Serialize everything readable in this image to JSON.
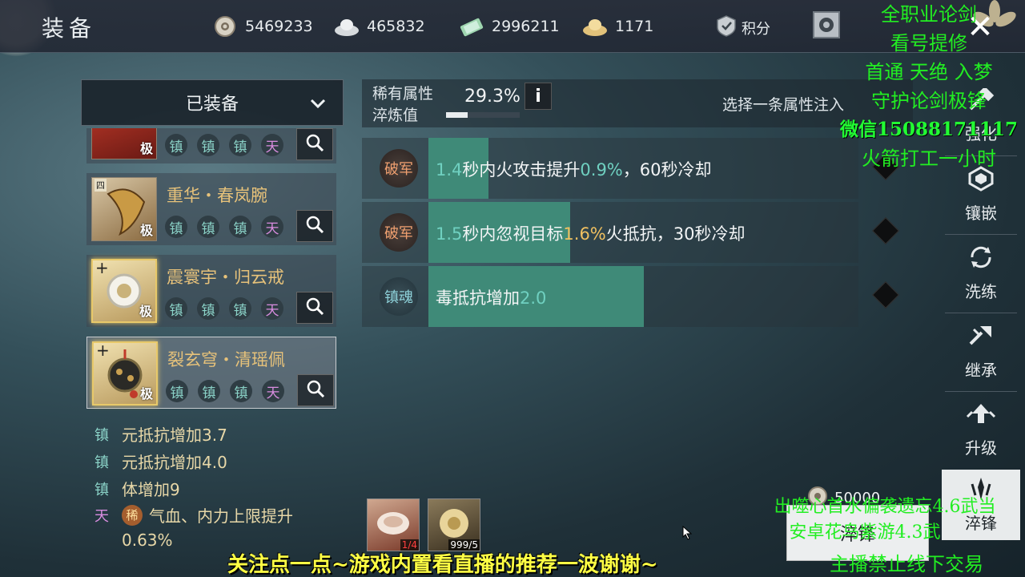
{
  "header": {
    "title": "装备",
    "currencies": [
      {
        "icon": "coin-icon",
        "value": "5469233"
      },
      {
        "icon": "silver-ingot-icon",
        "value": "465832"
      },
      {
        "icon": "jade-ticket-icon",
        "value": "2996211"
      },
      {
        "icon": "gold-ingot-icon",
        "value": "1171"
      }
    ],
    "score_label": "积分"
  },
  "left": {
    "dropdown_label": "已装备",
    "items": [
      {
        "name": "",
        "grade": "极",
        "gems": [
          "镇",
          "镇",
          "镇",
          "天"
        ]
      },
      {
        "name": "重华・春岚腕",
        "grade": "极",
        "gems": [
          "镇",
          "镇",
          "镇",
          "天"
        ],
        "badge": "四"
      },
      {
        "name": "震寰宇・归云戒",
        "grade": "极",
        "gems": [
          "镇",
          "镇",
          "镇",
          "天"
        ],
        "badge": "+"
      },
      {
        "name": "裂玄穹・清瑶佩",
        "grade": "极",
        "gems": [
          "镇",
          "镇",
          "镇",
          "天"
        ],
        "badge": "+",
        "selected": true
      }
    ],
    "attributes": [
      {
        "tag": "镇",
        "text": "元抵抗增加3.7"
      },
      {
        "tag": "镇",
        "text": "元抵抗增加4.0"
      },
      {
        "tag": "镇",
        "text": "体增加9"
      },
      {
        "tag": "天",
        "rare": "稀",
        "text": "气血、内力上限提升",
        "text2": "0.63%"
      }
    ]
  },
  "rarity": {
    "label_line1": "稀有属性",
    "label_line2": "淬炼值",
    "percent": "29.3%",
    "progress": 0.293,
    "info": "i",
    "select_hint": "选择一条属性注入"
  },
  "inject_rows": [
    {
      "type": "破军",
      "fill": 0.14,
      "v1": "1.4",
      "t1": "秒内火攻击提升",
      "v2": "0.9%",
      "t2": "，60秒冷却"
    },
    {
      "type": "破军",
      "fill": 0.33,
      "v1": "1.5",
      "t1": "秒内忽视目标",
      "v2": "1.6%",
      "t2": "火抵抗，30秒冷却"
    },
    {
      "type": "镇魂",
      "fill": 0.5,
      "v1": "",
      "t1": "毒抵抗增加",
      "v2": "2.0",
      "t2": ""
    }
  ],
  "right_menu": [
    {
      "label": "强化",
      "icon": "hammer-icon"
    },
    {
      "label": "镶嵌",
      "icon": "gem-socket-icon"
    },
    {
      "label": "洗练",
      "icon": "refresh-icon"
    },
    {
      "label": "继承",
      "icon": "inherit-icon"
    },
    {
      "label": "升级",
      "icon": "upgrade-icon"
    },
    {
      "label": "淬锋",
      "icon": "temper-icon",
      "active": true
    }
  ],
  "bottom": {
    "materials": [
      {
        "count": "1/4",
        "count_color": "#ff4040"
      },
      {
        "count": "999/5",
        "count_color": "#ffffff"
      }
    ],
    "cost": "50000",
    "action_label": "淬锋"
  },
  "overlay": {
    "bottom_text": "关注点一点~游戏内置看直播的推荐一波谢谢~",
    "right_top_lines": [
      "全职业论剑",
      "看号提修",
      "首通 天绝 入梦",
      "守护论剑极锋",
      "微信15088171117",
      "火箭打工一小时"
    ],
    "right_bottom_lines": [
      "出噬心首水偏袭遗忘4.6武当",
      "安卓花鸟紫游4.3武",
      "主播禁止线下交易"
    ]
  }
}
